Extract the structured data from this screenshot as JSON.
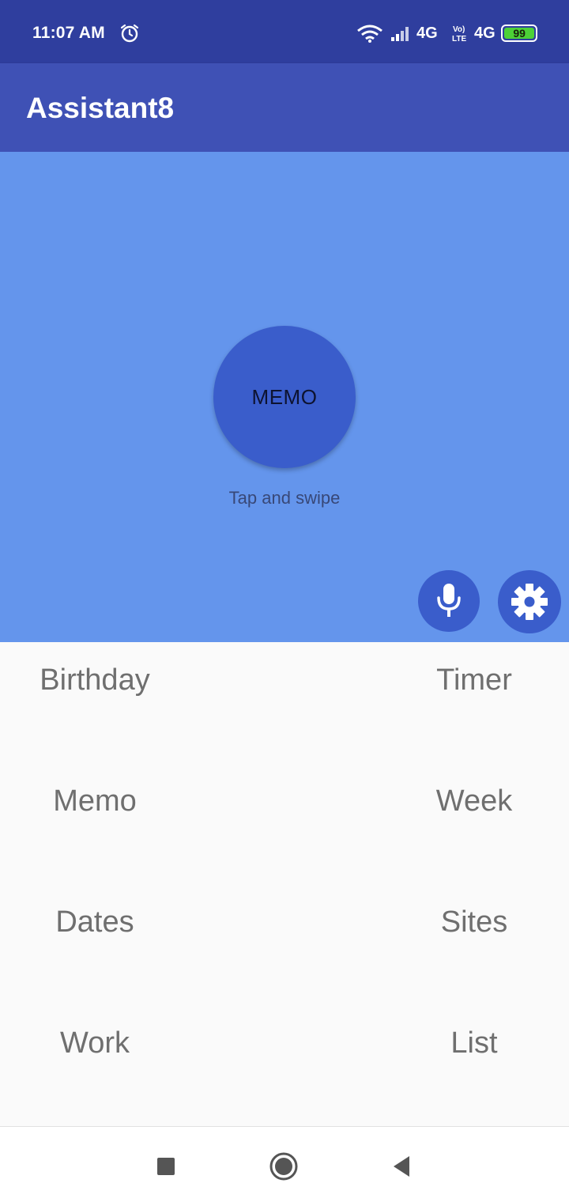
{
  "status_bar": {
    "time": "11:07 AM",
    "network_1": "4G",
    "network_2": "4G",
    "battery_level": "99",
    "icons": [
      "alarm-icon",
      "wifi-icon",
      "signal-icon",
      "volte-icon",
      "battery-icon"
    ]
  },
  "app_bar": {
    "title": "Assistant8"
  },
  "hero": {
    "memo_button_label": "MEMO",
    "hint": "Tap and swipe",
    "background_color": "#6495ec",
    "accent_color": "#3a5dcb"
  },
  "grid": {
    "items": [
      {
        "label": "Birthday"
      },
      {
        "label": "Timer"
      },
      {
        "label": "Memo"
      },
      {
        "label": "Week"
      },
      {
        "label": "Dates"
      },
      {
        "label": "Sites"
      },
      {
        "label": "Work"
      },
      {
        "label": "List"
      }
    ]
  },
  "actions": {
    "mic_icon": "microphone-icon",
    "settings_icon": "gear-icon"
  },
  "nav_bar": {
    "icons": [
      "recents-icon",
      "home-icon",
      "back-icon"
    ]
  }
}
